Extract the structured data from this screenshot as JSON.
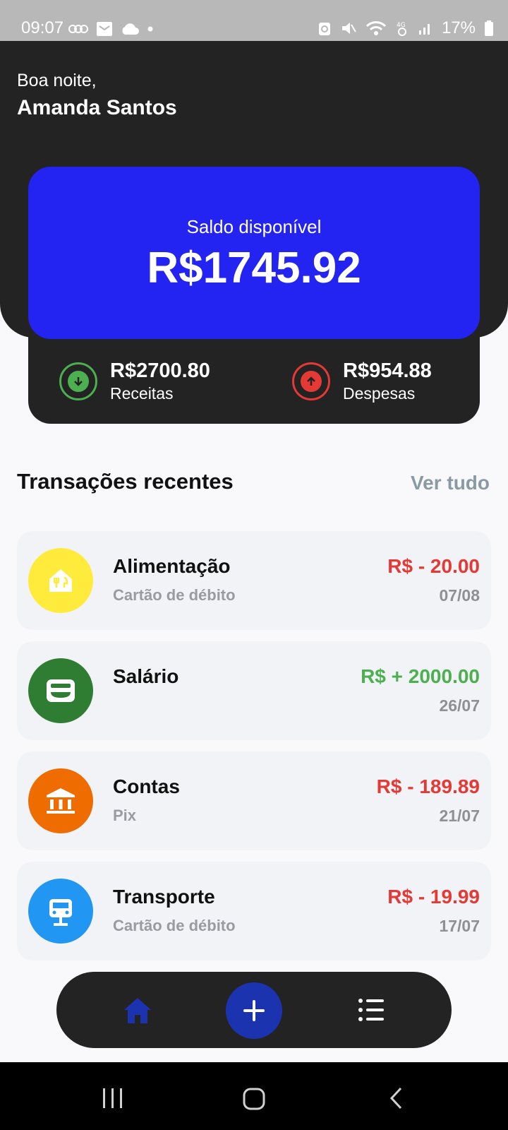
{
  "status_bar": {
    "time": "09:07",
    "battery": "17%"
  },
  "header": {
    "greeting": "Boa noite,",
    "user_name": "Amanda Santos"
  },
  "summary": {
    "balance_label": "Saldo disponível",
    "balance_value": "R$1745.92",
    "income_value": "R$2700.80",
    "income_label": "Receitas",
    "expense_value": "R$954.88",
    "expense_label": "Despesas"
  },
  "transactions_section": {
    "title": "Transações recentes",
    "see_all": "Ver tudo"
  },
  "transactions": [
    {
      "name": "Alimentação",
      "method": "Cartão de débito",
      "amount": "R$ - 20.00",
      "date": "07/08",
      "icon": "restaurant-icon",
      "icon_color": "#ffeb3b",
      "amount_color": "#e53935"
    },
    {
      "name": "Salário",
      "method": "",
      "amount": "R$ + 2000.00",
      "date": "26/07",
      "icon": "wallet-icon",
      "icon_color": "#2e7d32",
      "amount_color": "#4caf50"
    },
    {
      "name": "Contas",
      "method": "Pix",
      "amount": "R$ - 189.89",
      "date": "21/07",
      "icon": "bank-icon",
      "icon_color": "#ef6c00",
      "amount_color": "#e53935"
    },
    {
      "name": "Transporte",
      "method": "Cartão de débito",
      "amount": "R$ - 19.99",
      "date": "17/07",
      "icon": "car-icon",
      "icon_color": "#2196f3",
      "amount_color": "#e53935"
    }
  ],
  "colors": {
    "balance_card": "#2323f2",
    "dark_bg": "#232323",
    "income": "#4caf50",
    "expense": "#e53935",
    "nav_active": "#1c33b0"
  }
}
